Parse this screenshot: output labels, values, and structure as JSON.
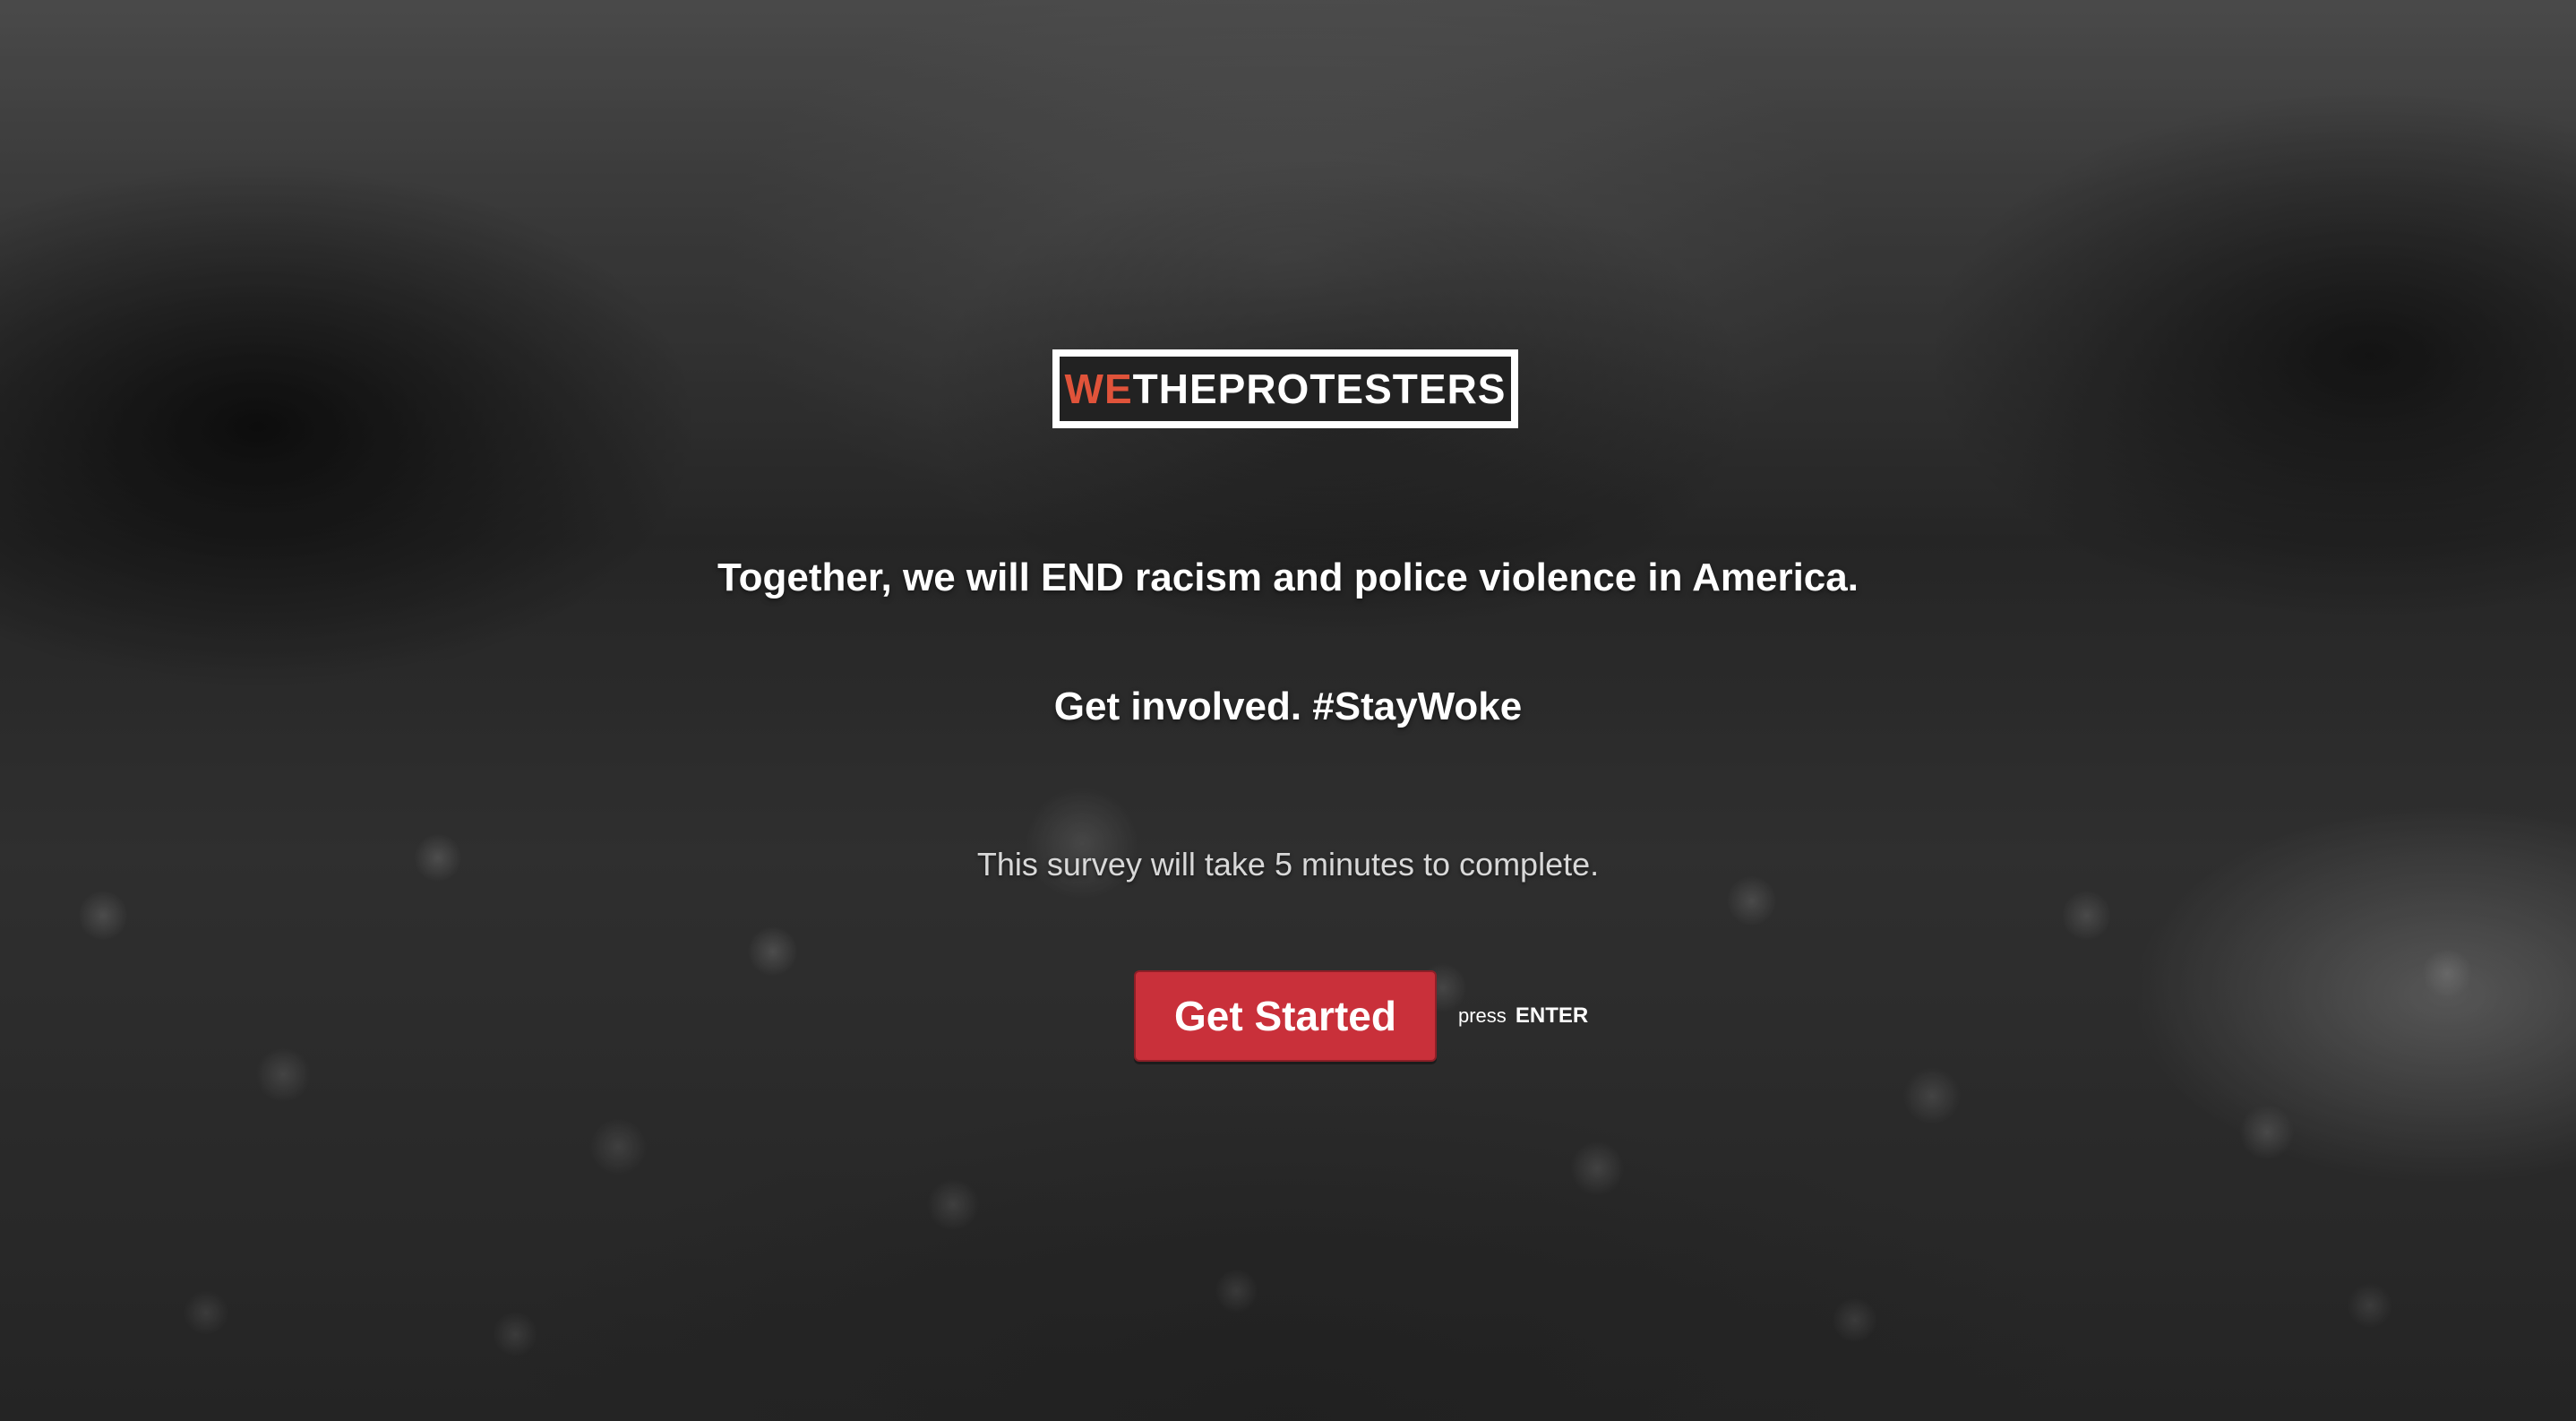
{
  "logo": {
    "part1": "WE",
    "part2": "THEPROTESTERS"
  },
  "headline": "Together, we will END racism and police violence in America.",
  "subhead": "Get involved. #StayWoke",
  "note": "This survey will take 5 minutes to complete.",
  "cta": {
    "button_label": "Get Started",
    "hint_prefix": "press",
    "hint_key": "ENTER"
  },
  "colors": {
    "accent": "#c9303a",
    "logo_red": "#e0533a",
    "text": "#ffffff"
  }
}
